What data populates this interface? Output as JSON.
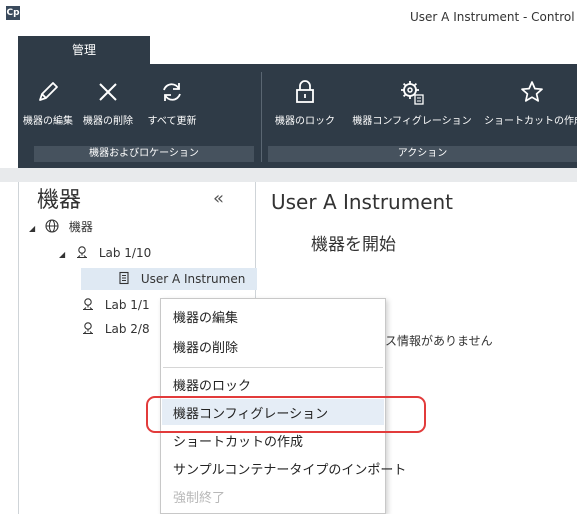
{
  "window": {
    "logo": "Cp",
    "title": "User A Instrument - Control"
  },
  "ribbon": {
    "tab_label": "管理",
    "buttons": [
      {
        "label": "機器の編集",
        "icon": "pencil-icon"
      },
      {
        "label": "機器の削除",
        "icon": "close-icon"
      },
      {
        "label": "すべて更新",
        "icon": "refresh-icon"
      },
      {
        "label": "機器のロック",
        "icon": "lock-icon"
      },
      {
        "label": "機器コンフィグレーション",
        "icon": "config-gear-icon"
      },
      {
        "label": "ショートカットの作成",
        "icon": "star-icon"
      }
    ],
    "groups": [
      {
        "label": "機器およびロケーション"
      },
      {
        "label": "アクション"
      }
    ]
  },
  "left_panel": {
    "title": "機器",
    "collapse_glyph": "«",
    "tree": [
      {
        "label": "機器",
        "icon": "globe-icon"
      },
      {
        "label": "Lab 1/10",
        "icon": "location-pin-icon"
      },
      {
        "label": "User A Instrumen",
        "icon": "instrument-icon"
      },
      {
        "label": "Lab 1/1",
        "icon": "location-pin-icon"
      },
      {
        "label": "Lab 2/8",
        "icon": "location-pin-icon"
      }
    ]
  },
  "right_panel": {
    "title": "User A Instrument",
    "subtitle": "機器を開始",
    "status": "ータス情報がありません"
  },
  "context_menu": {
    "items": [
      {
        "label": "機器の編集",
        "enabled": true
      },
      {
        "label": "機器の削除",
        "enabled": true
      },
      {
        "label": "機器のロック",
        "enabled": true
      },
      {
        "label": "機器コンフィグレーション",
        "enabled": true,
        "highlighted": true
      },
      {
        "label": "ショートカットの作成",
        "enabled": true
      },
      {
        "label": "サンプルコンテナータイプのインポート",
        "enabled": true
      },
      {
        "label": "強制終了",
        "enabled": false
      }
    ]
  },
  "colors": {
    "ribbon_bg": "#2f3b47",
    "highlight_ring": "#e23b3b",
    "selected_row": "#dfe9f3"
  }
}
